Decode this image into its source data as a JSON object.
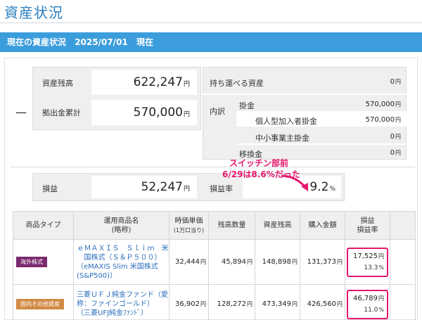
{
  "page": {
    "title": "資産状況"
  },
  "header_bar": {
    "label": "現在の資産状況",
    "date": "2025/07/01",
    "suffix": "現在"
  },
  "summary": {
    "asset_balance": {
      "label": "資産残高",
      "value": "622,247",
      "unit": "円"
    },
    "contribution_total": {
      "label": "拠出金累計",
      "value": "570,000",
      "unit": "円"
    },
    "portable_assets": {
      "label": "持ち運べる資産",
      "value": "0",
      "unit": "円"
    },
    "breakdown": {
      "label": "内訳",
      "contributions": {
        "label": "掛金",
        "value": "570,000",
        "unit": "円"
      },
      "individual": {
        "label": "個人型加入者掛金",
        "value": "570,000",
        "unit": "円"
      },
      "smb": {
        "label": "中小事業主掛金",
        "value": "0",
        "unit": "円"
      },
      "transfer": {
        "label": "移換金",
        "value": "0",
        "unit": "円"
      }
    },
    "profit": {
      "label": "損益",
      "value": "52,247",
      "unit": "円"
    },
    "profit_rate": {
      "label": "損益率",
      "value": "9.2",
      "unit": "%"
    }
  },
  "annotation": {
    "line1": "スイッチン部前",
    "line2": "6/29は8.6%だった"
  },
  "table": {
    "headers": {
      "type": "商品タイプ",
      "name": "運用商品名",
      "name_sub": "(略称)",
      "unit_price": "時価単価",
      "unit_price_sub": "(1万口当り)",
      "quantity": "残高数量",
      "balance": "資産残高",
      "purchase": "購入金額",
      "pl": "損益",
      "pl_rate": "損益率"
    },
    "rows": [
      {
        "type": "海外株式",
        "type_color": "#7a2a6e",
        "name": "ｅＭＡＸＩＳ　Ｓｌｉｍ　米国株式（Ｓ＆Ｐ５００）",
        "short": "（eMAXIS Slim 米国株式(S&P500)）",
        "unit_price": "32,444",
        "quantity": "45,894",
        "balance": "148,898",
        "purchase": "131,373",
        "pl": "17,525",
        "pl_rate": "13.3",
        "yen": "円",
        "pct": "%"
      },
      {
        "type": "国内その他資産",
        "type_color": "#d28b46",
        "name": "三菱ＵＦＪ純金ファンド（愛称：ファインゴールド）",
        "short": "（三菱UFJ純金ﾌｧﾝﾄﾞ）",
        "unit_price": "36,902",
        "quantity": "128,272",
        "balance": "473,349",
        "purchase": "426,560",
        "pl": "46,789",
        "pl_rate": "11.0",
        "yen": "円",
        "pct": "%"
      }
    ]
  }
}
